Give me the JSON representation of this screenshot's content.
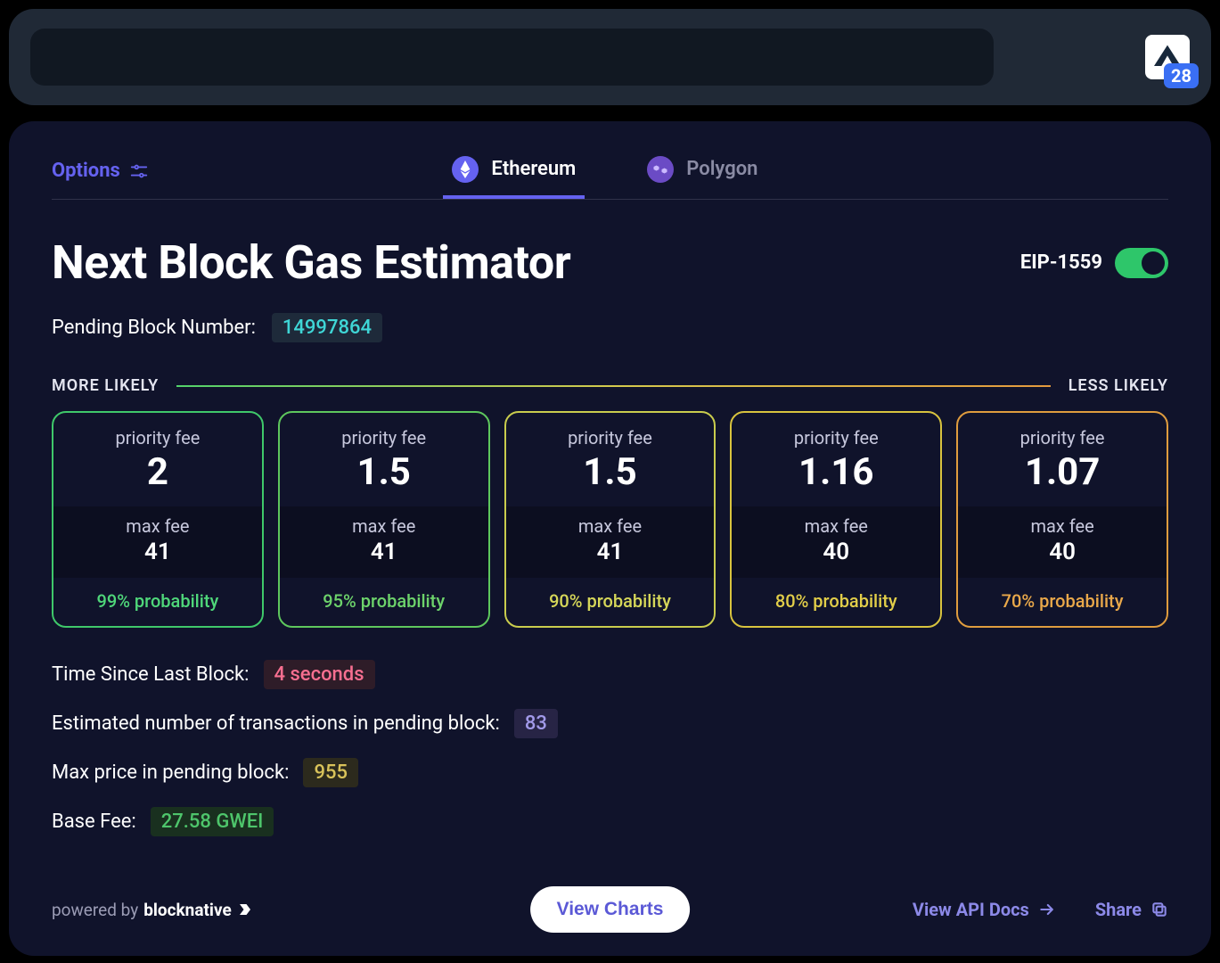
{
  "topbar": {
    "badge": "28"
  },
  "tabs": {
    "options_label": "Options",
    "chains": [
      {
        "label": "Ethereum",
        "active": true
      },
      {
        "label": "Polygon",
        "active": false
      }
    ]
  },
  "title": "Next Block Gas Estimator",
  "eip": {
    "label": "EIP-1559"
  },
  "pending": {
    "label": "Pending Block Number:",
    "value": "14997864"
  },
  "likely": {
    "more": "MORE LIKELY",
    "less": "LESS LIKELY"
  },
  "card_labels": {
    "priority": "priority fee",
    "max": "max fee"
  },
  "cards": [
    {
      "priority": "2",
      "max": "41",
      "prob": "99% probability"
    },
    {
      "priority": "1.5",
      "max": "41",
      "prob": "95% probability"
    },
    {
      "priority": "1.5",
      "max": "41",
      "prob": "90% probability"
    },
    {
      "priority": "1.16",
      "max": "40",
      "prob": "80% probability"
    },
    {
      "priority": "1.07",
      "max": "40",
      "prob": "70% probability"
    }
  ],
  "info": {
    "time_label": "Time Since Last Block:",
    "time_value": "4 seconds",
    "tx_label": "Estimated number of transactions in pending block:",
    "tx_value": "83",
    "maxprice_label": "Max price in pending block:",
    "maxprice_value": "955",
    "basefee_label": "Base Fee:",
    "basefee_value": "27.58 GWEI"
  },
  "footer": {
    "powered_prefix": "powered by ",
    "powered_brand": "blocknative",
    "view_charts": "View Charts",
    "api_docs": "View API Docs",
    "share": "Share"
  }
}
